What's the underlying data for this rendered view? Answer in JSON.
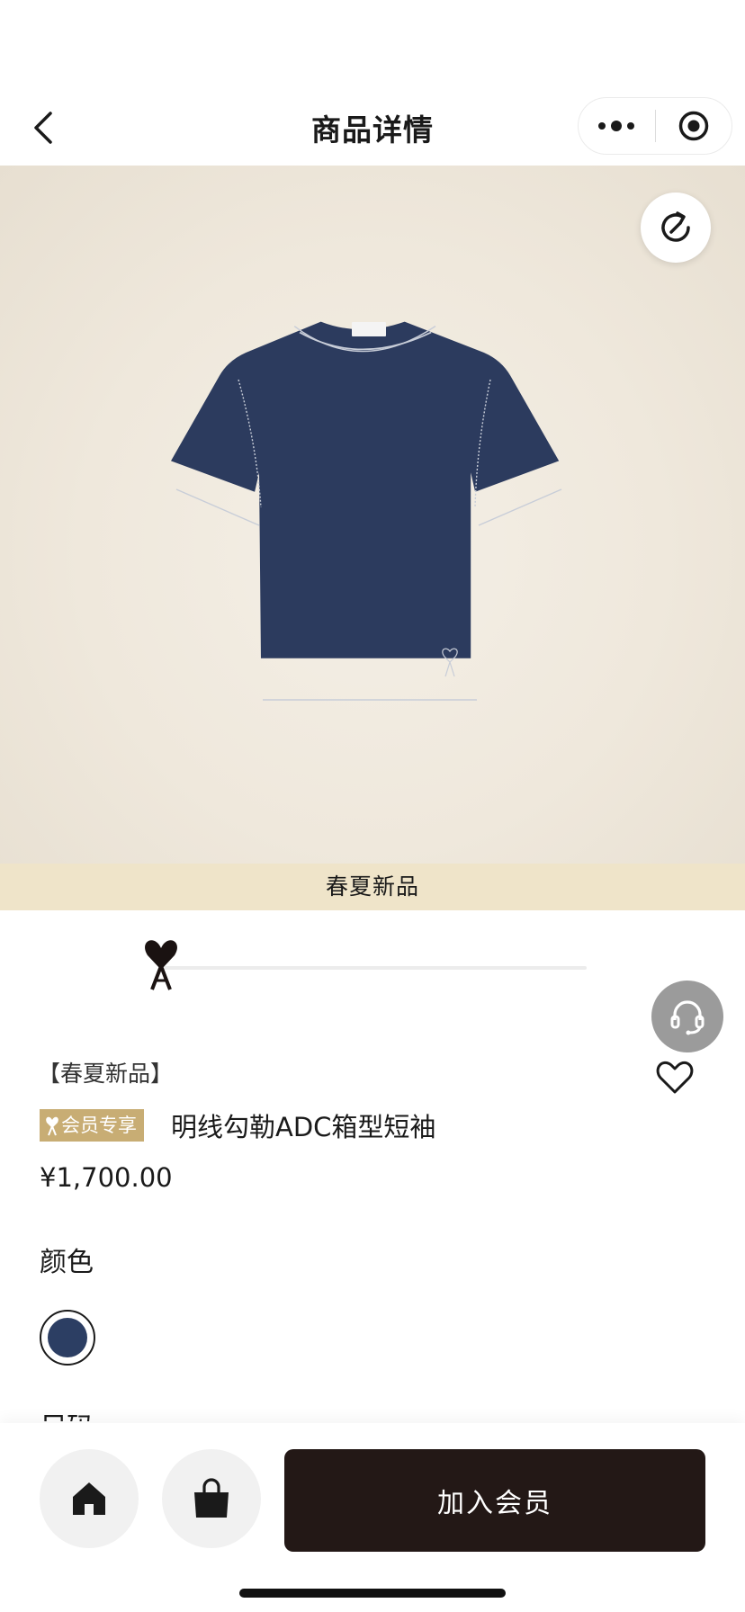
{
  "header": {
    "title": "商品详情",
    "back_icon": "chevron-left-icon",
    "more_icon": "more-dots-icon",
    "close_icon": "target-circle-icon"
  },
  "hero": {
    "share_icon": "share-refresh-icon",
    "image": "navy-tshirt-product-image",
    "banner_text": "春夏新品"
  },
  "progress": {
    "logo": "ami-heart-logo-icon",
    "value": 0
  },
  "side_actions": {
    "service_icon": "headset-icon",
    "favorite_icon": "heart-outline-icon"
  },
  "product": {
    "tag": "【春夏新品】",
    "badge_text": "会员专享",
    "title": "明线勾勒ADC箱型短袖",
    "price": "¥1,700.00",
    "color_label": "颜色",
    "colors": [
      {
        "name": "navy",
        "hex": "#2c3e63",
        "selected": true
      }
    ],
    "size_label": "尺码"
  },
  "bottom_bar": {
    "home_icon": "home-icon",
    "bag_icon": "shopping-bag-icon",
    "join_label": "加入会员"
  },
  "colors": {
    "banner": "#efe4c9",
    "badge": "#c8ad74",
    "join_button": "#231816",
    "product_navy": "#2c3e63"
  }
}
